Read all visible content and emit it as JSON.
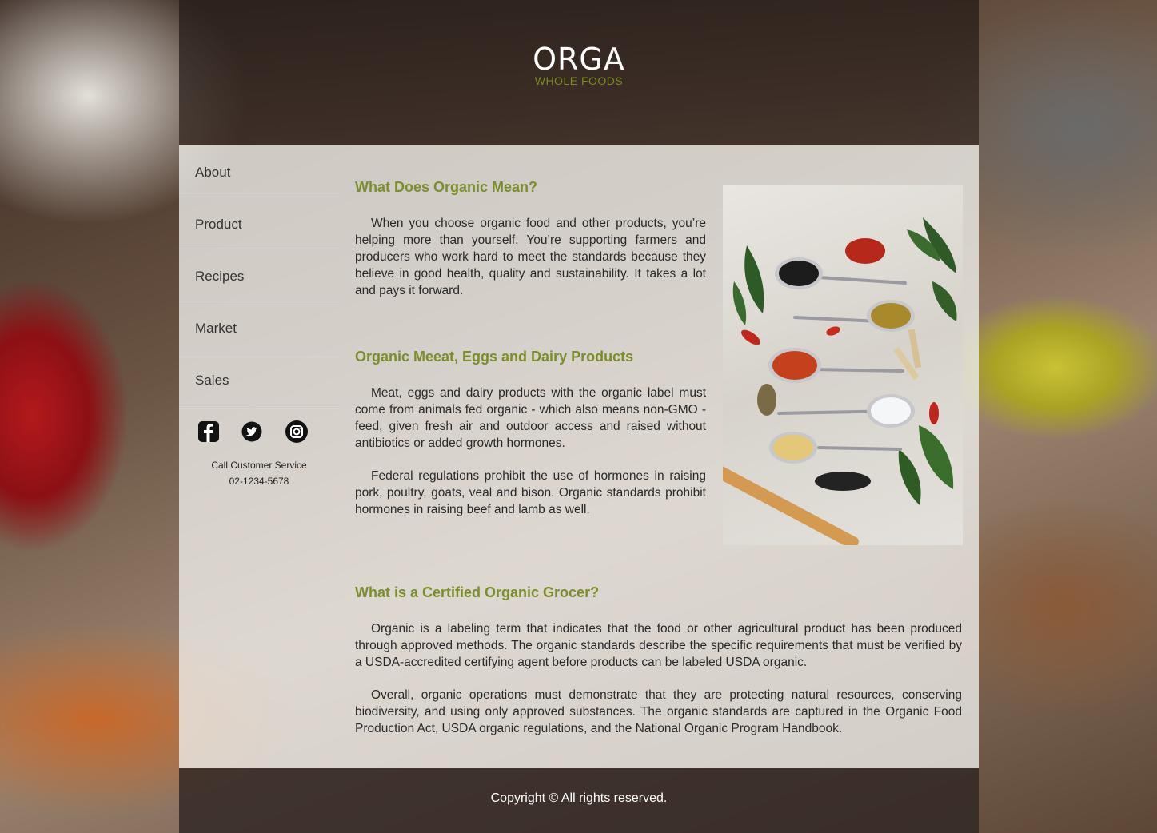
{
  "brand": {
    "name": "ORGA",
    "tagline": "WHOLE FOODS"
  },
  "nav": {
    "items": [
      {
        "label": "About"
      },
      {
        "label": "Product"
      },
      {
        "label": "Recipes"
      },
      {
        "label": "Market"
      },
      {
        "label": "Sales"
      }
    ]
  },
  "social": [
    "facebook-icon",
    "twitter-icon",
    "instagram-icon"
  ],
  "contact": {
    "label": "Call Customer Service",
    "phone": "02-1234-5678"
  },
  "sections": [
    {
      "title": "What Does Organic Mean?",
      "paragraphs": [
        "When you choose organic food and other products, you’re helping more than yourself. You’re supporting farmers and producers who work hard to meet the standards because they believe in good health, quality and sustainability. It takes a lot and pays it forward."
      ]
    },
    {
      "title": "Organic Meeat, Eggs and Dairy Products",
      "paragraphs": [
        "Meat, eggs and dairy products with the organic label must come from animals fed organic - which also means non-GMO - feed, given fresh air and outdoor access and raised without antibiotics or added growth hormones.",
        "Federal regulations prohibit the use of hormones in raising pork, poultry, goats, veal and bison. Organic standards prohibit hormones in raising beef and lamb as well."
      ]
    },
    {
      "title": "What is a Certified Organic Grocer?",
      "paragraphs": [
        "Organic is a labeling term that indicates that the food or other agricultural product has been produced through approved methods. The organic standards describe the specific requirements that must be verified by a USDA-accredited certifying agent before products can be labeled USDA organic.",
        "Overall, organic operations must demonstrate that they are protecting natural resources, conserving biodiversity, and using only approved substances. The organic standards are captured in the Organic Food Production Act, USDA organic regulations, and the National Organic Program Handbook."
      ]
    }
  ],
  "colors": {
    "accent": "#7c8e2c",
    "header": "#2f2520",
    "panel": "#eeece8"
  },
  "footer": {
    "copyright": "Copyright © All rights reserved."
  }
}
